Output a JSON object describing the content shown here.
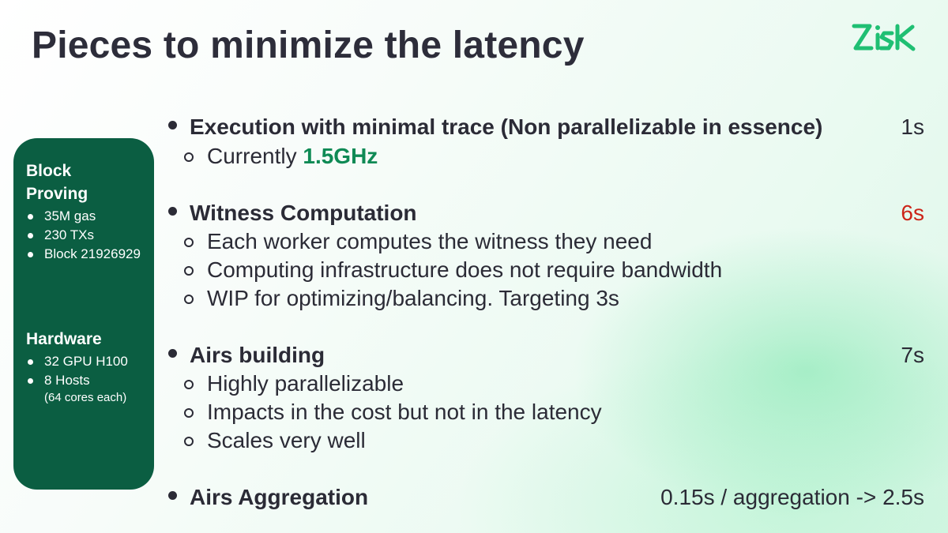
{
  "title": "Pieces to minimize the latency",
  "logo": {
    "text": "ZisK",
    "color": "#1fbf73"
  },
  "sidebar": {
    "block_heading": "Block Proving",
    "block_items": [
      "35M gas",
      "230 TXs",
      "Block 21926929"
    ],
    "hardware_heading": "Hardware",
    "hardware_items": [
      "32 GPU H100",
      "8 Hosts"
    ],
    "hardware_note": "(64 cores each)",
    "background_color": "#0b5e42"
  },
  "pieces": [
    {
      "label": "Execution with minimal trace (Non parallelizable in essence)",
      "time": "1s",
      "subitems": [
        {
          "prefix": "Currently ",
          "highlight": "1.5GHz"
        }
      ]
    },
    {
      "label": "Witness Computation",
      "time": "6s",
      "time_color": "#cc2418",
      "subitems": [
        "Each worker computes the witness they need",
        "Computing infrastructure does not require bandwidth",
        "WIP for optimizing/balancing. Targeting 3s"
      ]
    },
    {
      "label": "Airs building",
      "time": "7s",
      "subitems": [
        "Highly parallelizable",
        "Impacts in the cost but not in the latency",
        "Scales very well"
      ]
    },
    {
      "label": "Airs Aggregation",
      "time": "0.15s / aggregation -> 2.5s",
      "subitems": []
    }
  ],
  "colors": {
    "accent_green": "#0f8a55",
    "text": "#2b2b36"
  }
}
